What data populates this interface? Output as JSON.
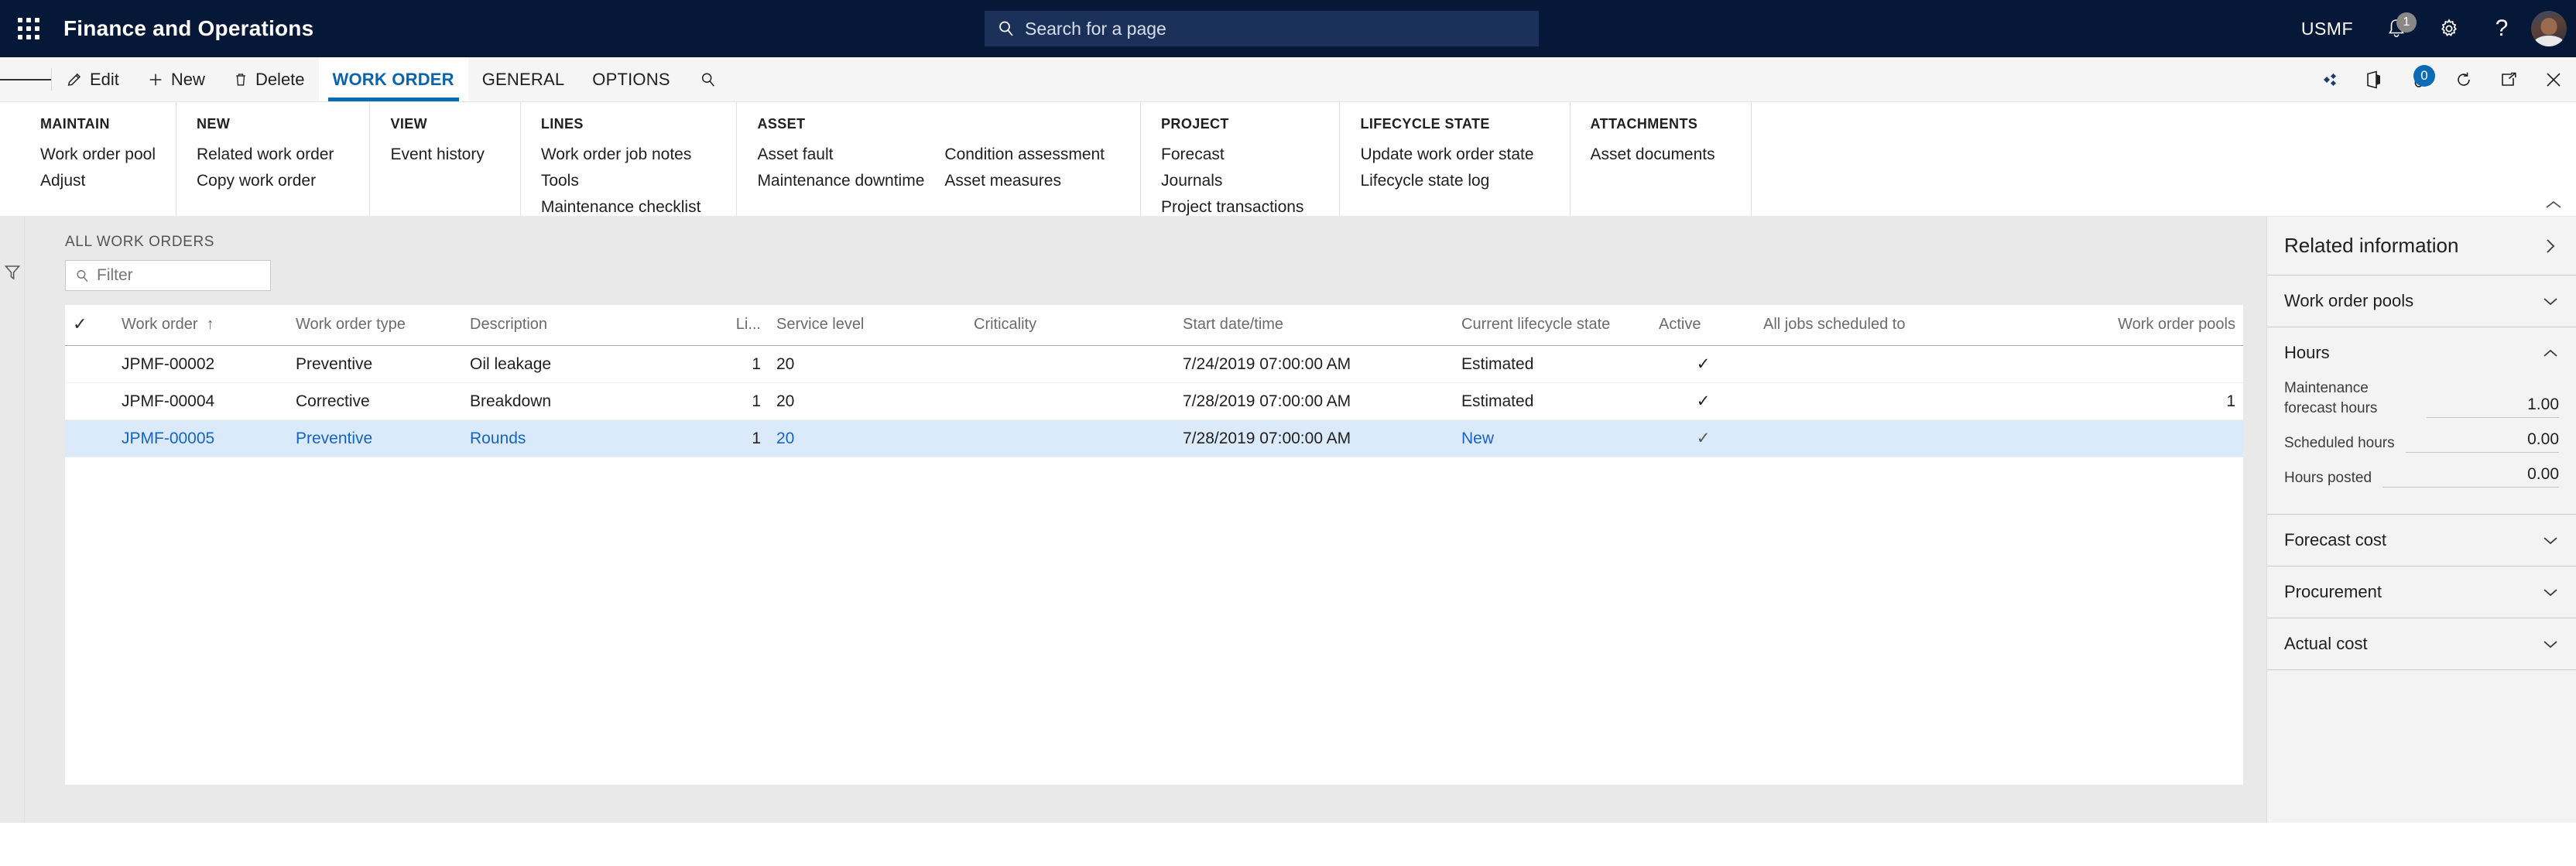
{
  "topbar": {
    "app_title": "Finance and Operations",
    "waffle_icon": "app-launcher-icon",
    "search_placeholder": "Search for a page",
    "search_icon": "search-icon",
    "company": "USMF",
    "notifications_icon": "bell-icon",
    "notifications_count": "1",
    "settings_icon": "gear-icon",
    "help_icon": "question-mark-icon",
    "avatar_icon": "user-avatar"
  },
  "commandbar": {
    "menu_icon": "hamburger-menu-icon",
    "edit_label": "Edit",
    "edit_icon": "pencil-icon",
    "new_label": "New",
    "new_icon": "plus-icon",
    "delete_label": "Delete",
    "delete_icon": "trash-icon",
    "tabs": [
      {
        "label": "WORK ORDER",
        "active": true
      },
      {
        "label": "GENERAL",
        "active": false
      },
      {
        "label": "OPTIONS",
        "active": false
      }
    ],
    "search_icon": "search-icon",
    "right_icons": [
      {
        "name": "relationships-icon"
      },
      {
        "name": "office-apps-icon"
      },
      {
        "name": "attachments-paperclip-icon",
        "badge": "0"
      },
      {
        "name": "refresh-icon"
      },
      {
        "name": "open-in-new-window-icon"
      },
      {
        "name": "close-icon"
      }
    ]
  },
  "ribbon": {
    "collapse_icon": "chevron-up-icon",
    "groups": [
      {
        "title": "MAINTAIN",
        "columns": [
          [
            "Work order pool",
            "Adjust"
          ]
        ]
      },
      {
        "title": "NEW",
        "columns": [
          [
            "Related work order",
            "Copy work order"
          ]
        ]
      },
      {
        "title": "VIEW",
        "columns": [
          [
            "Event history"
          ]
        ]
      },
      {
        "title": "LINES",
        "columns": [
          [
            "Work order job notes",
            "Tools",
            "Maintenance checklist"
          ]
        ]
      },
      {
        "title": "ASSET",
        "columns": [
          [
            "Asset fault",
            "Maintenance downtime"
          ],
          [
            "Condition assessment",
            "Asset measures"
          ]
        ]
      },
      {
        "title": "PROJECT",
        "columns": [
          [
            "Forecast",
            "Journals",
            "Project transactions"
          ]
        ]
      },
      {
        "title": "LIFECYCLE STATE",
        "columns": [
          [
            "Update work order state",
            "Lifecycle state log"
          ]
        ]
      },
      {
        "title": "ATTACHMENTS",
        "columns": [
          [
            "Asset documents"
          ]
        ]
      }
    ]
  },
  "main": {
    "rail_filter_icon": "funnel-filter-icon",
    "grid_caption": "ALL WORK ORDERS",
    "filter_placeholder": "Filter",
    "filter_icon": "search-icon",
    "columns": [
      {
        "label": "",
        "key": "check",
        "align": "center"
      },
      {
        "label": "Work order",
        "key": "work_order",
        "sort": "asc"
      },
      {
        "label": "Work order type",
        "key": "type"
      },
      {
        "label": "Description",
        "key": "description"
      },
      {
        "label": "Li...",
        "key": "li",
        "align": "right"
      },
      {
        "label": "Service level",
        "key": "service_level"
      },
      {
        "label": "Criticality",
        "key": "criticality"
      },
      {
        "label": "Start date/time",
        "key": "start"
      },
      {
        "label": "Current lifecycle state",
        "key": "lifecycle"
      },
      {
        "label": "Active",
        "key": "active",
        "align": "center"
      },
      {
        "label": "All jobs scheduled to",
        "key": "scheduled_to"
      },
      {
        "label": "Work order pools",
        "key": "pools",
        "align": "right"
      }
    ],
    "header_check_icon": "checkmark-icon",
    "sort_asc_icon": "arrow-up-icon",
    "rows": [
      {
        "work_order": "JPMF-00002",
        "type": "Preventive",
        "description": "Oil leakage",
        "li": "1",
        "service_level": "20",
        "criticality": "",
        "start": "7/24/2019 07:00:00 AM",
        "lifecycle": "Estimated",
        "active": "✓",
        "scheduled_to": "",
        "pools": "",
        "selected": false
      },
      {
        "work_order": "JPMF-00004",
        "type": "Corrective",
        "description": "Breakdown",
        "li": "1",
        "service_level": "20",
        "criticality": "",
        "start": "7/28/2019 07:00:00 AM",
        "lifecycle": "Estimated",
        "active": "✓",
        "scheduled_to": "",
        "pools": "1",
        "selected": false
      },
      {
        "work_order": "JPMF-00005",
        "type": "Preventive",
        "description": "Rounds",
        "li": "1",
        "service_level": "20",
        "criticality": "",
        "start": "7/28/2019 07:00:00 AM",
        "lifecycle": "New",
        "active": "✓",
        "scheduled_to": "",
        "pools": "",
        "selected": true
      }
    ]
  },
  "right_pane": {
    "title": "Related information",
    "expand_icon": "chevron-right-icon",
    "sections": [
      {
        "title": "Work order pools",
        "expanded": false,
        "icon": "chevron-down-icon",
        "fields": []
      },
      {
        "title": "Hours",
        "expanded": true,
        "icon": "chevron-up-icon",
        "fields": [
          {
            "label": "Maintenance forecast hours",
            "value": "1.00"
          },
          {
            "label": "Scheduled hours",
            "value": "0.00"
          },
          {
            "label": "Hours posted",
            "value": "0.00"
          }
        ]
      },
      {
        "title": "Forecast cost",
        "expanded": false,
        "icon": "chevron-down-icon",
        "fields": []
      },
      {
        "title": "Procurement",
        "expanded": false,
        "icon": "chevron-down-icon",
        "fields": []
      },
      {
        "title": "Actual cost",
        "expanded": false,
        "icon": "chevron-down-icon",
        "fields": []
      }
    ]
  },
  "colors": {
    "topbar_bg": "#061838",
    "search_bg": "#1c3159",
    "accent_blue": "#0b6cb5",
    "link_blue": "#0a64ad",
    "selected_row": "#dbeafa",
    "panel_bg": "#f3f3f3",
    "body_bg": "#e9e9e9"
  }
}
